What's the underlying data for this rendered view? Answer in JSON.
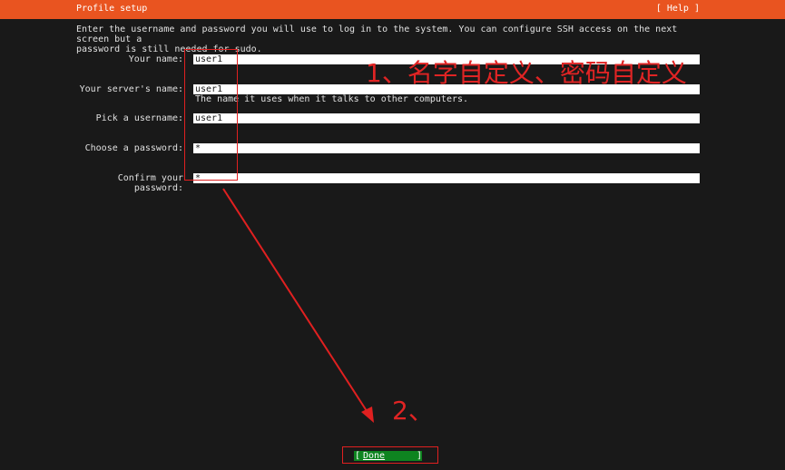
{
  "titlebar": {
    "title": "Profile setup",
    "help": "[ Help ]"
  },
  "intro": "Enter the username and password you will use to log in to the system. You can configure SSH access on the next screen but a\npassword is still needed for sudo.",
  "fields": {
    "name": {
      "label": "Your name:",
      "value": "user1"
    },
    "server": {
      "label": "Your server's name:",
      "value": "user1",
      "hint": "The name it uses when it talks to other computers."
    },
    "username": {
      "label": "Pick a username:",
      "value": "user1"
    },
    "password": {
      "label": "Choose a password:",
      "value": "*"
    },
    "confirm": {
      "label": "Confirm your password:",
      "value": "*"
    }
  },
  "done": {
    "open": "[",
    "label": "Done",
    "close": "]"
  },
  "annotations": {
    "step1": "1、名字自定义、密码自定义",
    "step2": "2、",
    "color": "#e02020"
  }
}
